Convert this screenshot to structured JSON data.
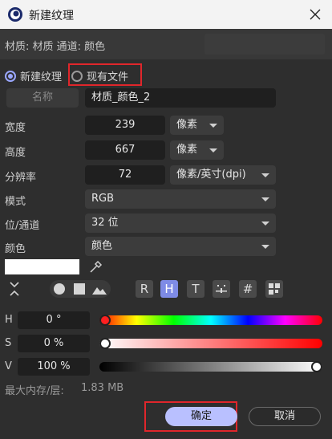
{
  "window": {
    "title": "新建纹理",
    "logo_icon": "cinema4d-logo-icon",
    "close_icon": "close-icon"
  },
  "infobar": {
    "path": "材质: 材质 通道: 颜色"
  },
  "source": {
    "new_texture": "新建纹理",
    "existing_file": "现有文件",
    "selected": "new_texture"
  },
  "name": {
    "button": "名称",
    "value": "材质_颜色_2"
  },
  "size": {
    "width_label": "宽度",
    "width_value": "239",
    "width_unit": "像素",
    "height_label": "高度",
    "height_value": "667",
    "height_unit": "像素",
    "resolution_label": "分辨率",
    "resolution_value": "72",
    "resolution_unit": "像素/英寸(dpi)"
  },
  "mode": {
    "label": "模式",
    "value": "RGB"
  },
  "depth": {
    "label": "位/通道",
    "value": "32 位"
  },
  "color": {
    "label": "颜色",
    "value": "颜色",
    "swatch": "#ffffff"
  },
  "tools": {
    "collapse_icon": "collapse-arrows-icon",
    "eyedropper_icon": "eyedropper-icon",
    "circle_icon": "circle-icon",
    "square_icon": "square-icon",
    "image_icon": "image-icon",
    "r": "R",
    "h": "H",
    "t": "T",
    "hash": "#",
    "grid_icon": "grid-icon",
    "dots_icon": "dots-icon",
    "active": "H"
  },
  "hsv": {
    "h_label": "H",
    "h_value": "0 °",
    "h_level": 0,
    "s_label": "S",
    "s_value": "0 %",
    "s_level": 0,
    "v_label": "V",
    "v_value": "100 %",
    "v_level": 100
  },
  "memory": {
    "label": "最大内存/层:",
    "value": "1.83 MB"
  },
  "buttons": {
    "ok": "确定",
    "cancel": "取消"
  },
  "colors": {
    "accent": "#b9c0ff",
    "radio_on": "#9aa7ff",
    "highlight": "#e0262b"
  }
}
